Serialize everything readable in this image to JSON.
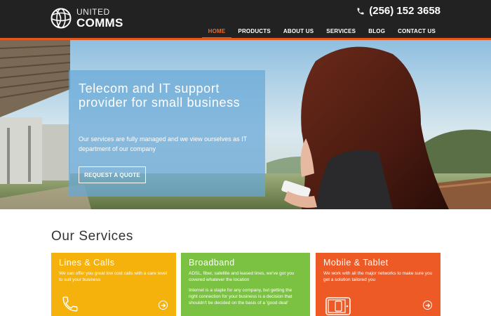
{
  "brand": {
    "name_top": "UNITED",
    "name_bottom": "COMMS"
  },
  "header": {
    "phone": "(256) 152 3658"
  },
  "nav": [
    {
      "label": "HOME",
      "active": true
    },
    {
      "label": "PRODUCTS",
      "active": false
    },
    {
      "label": "ABOUT US",
      "active": false
    },
    {
      "label": "SERVICES",
      "active": false
    },
    {
      "label": "BLOG",
      "active": false
    },
    {
      "label": "CONTACT US",
      "active": false
    }
  ],
  "hero": {
    "title": "Telecom and IT support provider for small business",
    "subtitle": "Our services are fully managed and we view ourselves as IT department of our company",
    "cta": "REQUEST A QUOTE"
  },
  "services": {
    "heading": "Our Services",
    "cards": [
      {
        "title": "Lines & Calls",
        "text": [
          "We can offer you great low cost calls with a care level to suit your business"
        ],
        "icon": "phone-icon"
      },
      {
        "title": "Broadband",
        "text": [
          "ADSL, fiber, satellite and leased lines, we've got you covered whatever the location",
          "Internet is a staple for any company, but getting the right connection for your business is a decision that shouldn't be decided on the basis of a 'good deal'"
        ],
        "icon": ""
      },
      {
        "title": "Mobile & Tablet",
        "text": [
          "We work with all the major networks to make sure you get a solution tailored you"
        ],
        "icon": "tablet-icon"
      }
    ]
  },
  "colors": {
    "header_bg": "#222222",
    "accent": "#e4571a",
    "card_yellow": "#f5b10c",
    "card_green": "#7cc242",
    "card_orange": "#ee5a25",
    "hero_box": "#66a8d7"
  }
}
